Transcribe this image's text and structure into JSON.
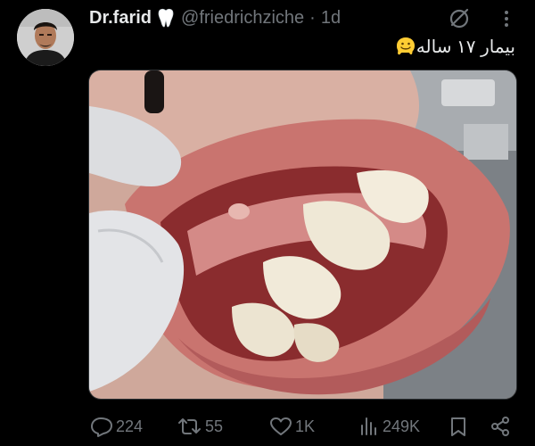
{
  "tweet": {
    "author": {
      "display_name": "Dr.farid",
      "badge_icon": "tooth-icon",
      "handle": "@friedrichziche",
      "separator": "·",
      "time": "1d"
    },
    "header_icons": [
      "grok-icon",
      "more-icon"
    ],
    "text": "بیمار ۱۷ ساله",
    "text_emoji": "melting-face-emoji",
    "media": {
      "type": "photo",
      "subject": "close-up of open mouth with gloved fingers retracting the lip"
    },
    "actions": {
      "reply": {
        "icon": "reply-icon",
        "count": "224"
      },
      "retweet": {
        "icon": "retweet-icon",
        "count": "55"
      },
      "like": {
        "icon": "heart-icon",
        "count": "1K"
      },
      "views": {
        "icon": "views-icon",
        "count": "249K"
      },
      "bookmark": {
        "icon": "bookmark-icon"
      },
      "share": {
        "icon": "share-icon"
      }
    }
  },
  "colors": {
    "background": "#000000",
    "primary_text": "#e7e9ea",
    "secondary_text": "#71767b",
    "border": "#2f3336"
  }
}
